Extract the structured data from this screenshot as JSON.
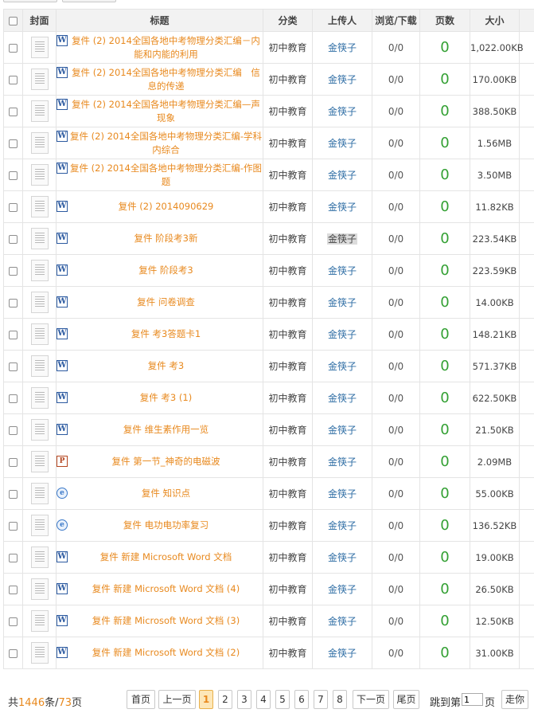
{
  "header": {
    "cover": "封面",
    "title": "标题",
    "category": "分类",
    "uploader": "上传人",
    "views": "浏览/下载",
    "pages": "页数",
    "size": "大小"
  },
  "rows": [
    {
      "icon": "word",
      "title": "复件 (2) 2014全国各地中考物理分类汇编－内能和内能的利用",
      "category": "初中教育",
      "uploader": "金筷子",
      "views": "0/0",
      "pages": "0",
      "size": "1,022.00KB"
    },
    {
      "icon": "word",
      "title": "复件 (2) 2014全国各地中考物理分类汇编　信息的传递",
      "category": "初中教育",
      "uploader": "金筷子",
      "views": "0/0",
      "pages": "0",
      "size": "170.00KB"
    },
    {
      "icon": "word",
      "title": "复件 (2) 2014全国各地中考物理分类汇编—声现象",
      "category": "初中教育",
      "uploader": "金筷子",
      "views": "0/0",
      "pages": "0",
      "size": "388.50KB"
    },
    {
      "icon": "word",
      "title": "复件 (2) 2014全国各地中考物理分类汇编-学科内综合",
      "category": "初中教育",
      "uploader": "金筷子",
      "views": "0/0",
      "pages": "0",
      "size": "1.56MB"
    },
    {
      "icon": "word",
      "title": "复件 (2) 2014全国各地中考物理分类汇编-作图题",
      "category": "初中教育",
      "uploader": "金筷子",
      "views": "0/0",
      "pages": "0",
      "size": "3.50MB"
    },
    {
      "icon": "word",
      "title": "复件 (2) 2014090629",
      "category": "初中教育",
      "uploader": "金筷子",
      "views": "0/0",
      "pages": "0",
      "size": "11.82KB"
    },
    {
      "icon": "word",
      "title": "复件 阶段考3新",
      "category": "初中教育",
      "uploader": "金筷子",
      "views": "0/0",
      "pages": "0",
      "size": "223.54KB",
      "highlight": true
    },
    {
      "icon": "word",
      "title": "复件 阶段考3",
      "category": "初中教育",
      "uploader": "金筷子",
      "views": "0/0",
      "pages": "0",
      "size": "223.59KB"
    },
    {
      "icon": "word",
      "title": "复件 问卷调查",
      "category": "初中教育",
      "uploader": "金筷子",
      "views": "0/0",
      "pages": "0",
      "size": "14.00KB"
    },
    {
      "icon": "word",
      "title": "复件 考3答题卡1",
      "category": "初中教育",
      "uploader": "金筷子",
      "views": "0/0",
      "pages": "0",
      "size": "148.21KB"
    },
    {
      "icon": "word",
      "title": "复件 考3",
      "category": "初中教育",
      "uploader": "金筷子",
      "views": "0/0",
      "pages": "0",
      "size": "571.37KB"
    },
    {
      "icon": "word",
      "title": "复件 考3 (1)",
      "category": "初中教育",
      "uploader": "金筷子",
      "views": "0/0",
      "pages": "0",
      "size": "622.50KB"
    },
    {
      "icon": "word",
      "title": "复件 维生素作用一览",
      "category": "初中教育",
      "uploader": "金筷子",
      "views": "0/0",
      "pages": "0",
      "size": "21.50KB"
    },
    {
      "icon": "ppt",
      "title": "复件 第一节_神奇的电磁波",
      "category": "初中教育",
      "uploader": "金筷子",
      "views": "0/0",
      "pages": "0",
      "size": "2.09MB"
    },
    {
      "icon": "html",
      "title": "复件 知识点",
      "category": "初中教育",
      "uploader": "金筷子",
      "views": "0/0",
      "pages": "0",
      "size": "55.00KB"
    },
    {
      "icon": "html",
      "title": "复件 电功电功率复习",
      "category": "初中教育",
      "uploader": "金筷子",
      "views": "0/0",
      "pages": "0",
      "size": "136.52KB"
    },
    {
      "icon": "word",
      "title": "复件 新建 Microsoft Word 文档",
      "category": "初中教育",
      "uploader": "金筷子",
      "views": "0/0",
      "pages": "0",
      "size": "19.00KB"
    },
    {
      "icon": "word",
      "title": "复件 新建 Microsoft Word 文档 (4)",
      "category": "初中教育",
      "uploader": "金筷子",
      "views": "0/0",
      "pages": "0",
      "size": "26.50KB"
    },
    {
      "icon": "word",
      "title": "复件 新建 Microsoft Word 文档 (3)",
      "category": "初中教育",
      "uploader": "金筷子",
      "views": "0/0",
      "pages": "0",
      "size": "12.50KB"
    },
    {
      "icon": "word",
      "title": "复件 新建 Microsoft Word 文档 (2)",
      "category": "初中教育",
      "uploader": "金筷子",
      "views": "0/0",
      "pages": "0",
      "size": "31.00KB"
    }
  ],
  "icons": {
    "word": {
      "glyph": "W",
      "name": "word-doc-icon"
    },
    "ppt": {
      "glyph": "P",
      "name": "ppt-doc-icon"
    },
    "html": {
      "glyph": "e",
      "name": "web-doc-icon"
    }
  },
  "pagination": {
    "total_prefix": "共",
    "total_count": "1446",
    "total_mid": "条/",
    "total_pages": "73",
    "total_suffix": "页",
    "first": "首页",
    "prev": "上一页",
    "pages": [
      "1",
      "2",
      "3",
      "4",
      "5",
      "6",
      "7",
      "8"
    ],
    "current": "1",
    "next": "下一页",
    "last": "尾页",
    "jump_prefix": "跳到第",
    "jump_value": "1",
    "jump_suffix": "页",
    "go": "走你"
  },
  "colors": {
    "title_link": "#e8891e",
    "uploader_link": "#2e6da4",
    "pages_count": "#33a033",
    "header_bg": "#f2f2f2"
  }
}
